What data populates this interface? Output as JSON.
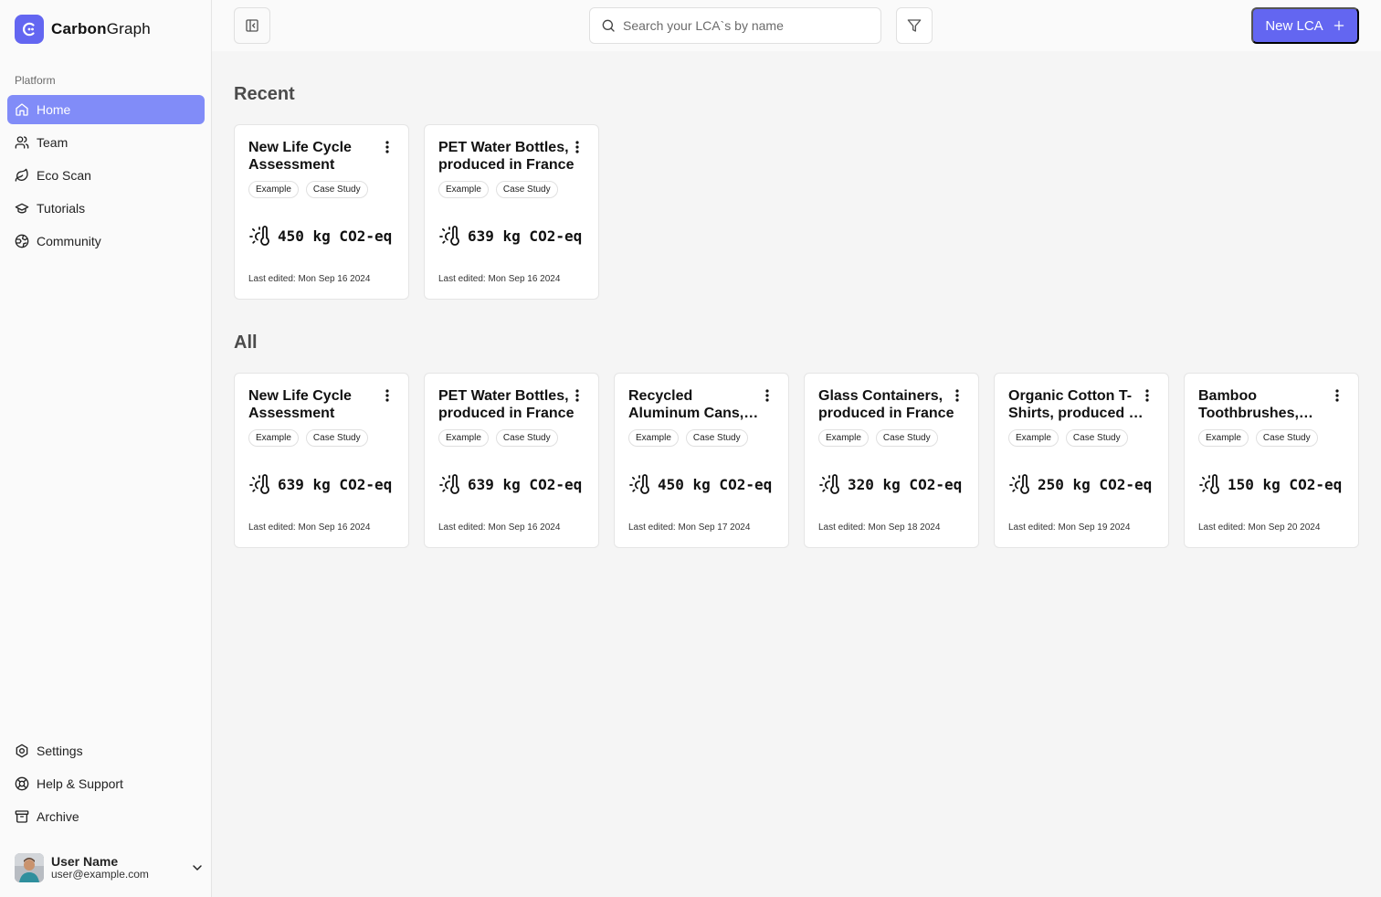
{
  "app": {
    "name_part1": "Carbon",
    "name_part2": "Graph"
  },
  "sidebar": {
    "section_label": "Platform",
    "items": [
      {
        "label": "Home",
        "icon": "home-icon",
        "active": true
      },
      {
        "label": "Team",
        "icon": "users-icon"
      },
      {
        "label": "Eco Scan",
        "icon": "leaf-icon"
      },
      {
        "label": "Tutorials",
        "icon": "graduation-cap-icon"
      },
      {
        "label": "Community",
        "icon": "globe-icon"
      }
    ],
    "bottom_items": [
      {
        "label": "Settings",
        "icon": "settings-icon"
      },
      {
        "label": "Help & Support",
        "icon": "lifebuoy-icon"
      },
      {
        "label": "Archive",
        "icon": "archive-icon"
      }
    ],
    "user": {
      "name": "User Name",
      "email": "user@example.com"
    }
  },
  "topbar": {
    "search_placeholder": "Search your LCA`s by name",
    "new_button_label": "New LCA"
  },
  "colors": {
    "accent": "#6366f1",
    "active_nav": "#818cf8"
  },
  "recent": {
    "heading": "Recent",
    "cards": [
      {
        "title": "New Life Cycle Assessment",
        "tags": [
          "Example",
          "Case Study"
        ],
        "emission": "450 kg CO2-eq",
        "edited": "Last edited: Mon Sep 16 2024"
      },
      {
        "title": "PET Water Bottles, produced in France",
        "tags": [
          "Example",
          "Case Study"
        ],
        "emission": "639 kg CO2-eq",
        "edited": "Last edited: Mon Sep 16 2024"
      }
    ]
  },
  "all": {
    "heading": "All",
    "cards": [
      {
        "title": "New Life Cycle Assessment",
        "tags": [
          "Example",
          "Case Study"
        ],
        "emission": "639 kg CO2-eq",
        "edited": "Last edited: Mon Sep 16 2024"
      },
      {
        "title": "PET Water Bottles, produced in France",
        "tags": [
          "Example",
          "Case Study"
        ],
        "emission": "639 kg CO2-eq",
        "edited": "Last edited: Mon Sep 16 2024"
      },
      {
        "title": "Recycled Aluminum Cans, produced in Germany",
        "tags": [
          "Example",
          "Case Study"
        ],
        "emission": "450 kg CO2-eq",
        "edited": "Last edited: Mon Sep 17 2024"
      },
      {
        "title": "Glass Containers, produced in France",
        "tags": [
          "Example",
          "Case Study"
        ],
        "emission": "320 kg CO2-eq",
        "edited": "Last edited: Mon Sep 18 2024"
      },
      {
        "title": "Organic Cotton T-Shirts, produced in India",
        "tags": [
          "Example",
          "Case Study"
        ],
        "emission": "250 kg CO2-eq",
        "edited": "Last edited: Mon Sep 19 2024"
      },
      {
        "title": "Bamboo Toothbrushes, produced in China",
        "tags": [
          "Example",
          "Case Study"
        ],
        "emission": "150 kg CO2-eq",
        "edited": "Last edited: Mon Sep 20 2024"
      }
    ]
  }
}
